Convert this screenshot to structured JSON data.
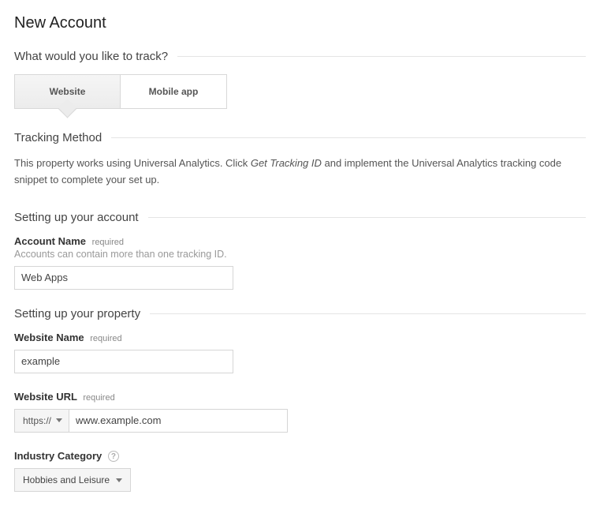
{
  "page_title": "New Account",
  "track_question": "What would you like to track?",
  "tabs": {
    "website": "Website",
    "mobile": "Mobile app"
  },
  "tracking_method": {
    "heading": "Tracking Method",
    "desc_before": "This property works using Universal Analytics. Click ",
    "desc_em": "Get Tracking ID",
    "desc_after": " and implement the Universal Analytics tracking code snippet to complete your set up."
  },
  "account_section": {
    "heading": "Setting up your account",
    "name_label": "Account Name",
    "required": "required",
    "hint": "Accounts can contain more than one tracking ID.",
    "value": "Web Apps"
  },
  "property_section": {
    "heading": "Setting up your property",
    "website_name_label": "Website Name",
    "website_name_value": "example",
    "website_url_label": "Website URL",
    "protocol": "https://",
    "url_value": "www.example.com",
    "industry_label": "Industry Category",
    "industry_value": "Hobbies and Leisure"
  }
}
